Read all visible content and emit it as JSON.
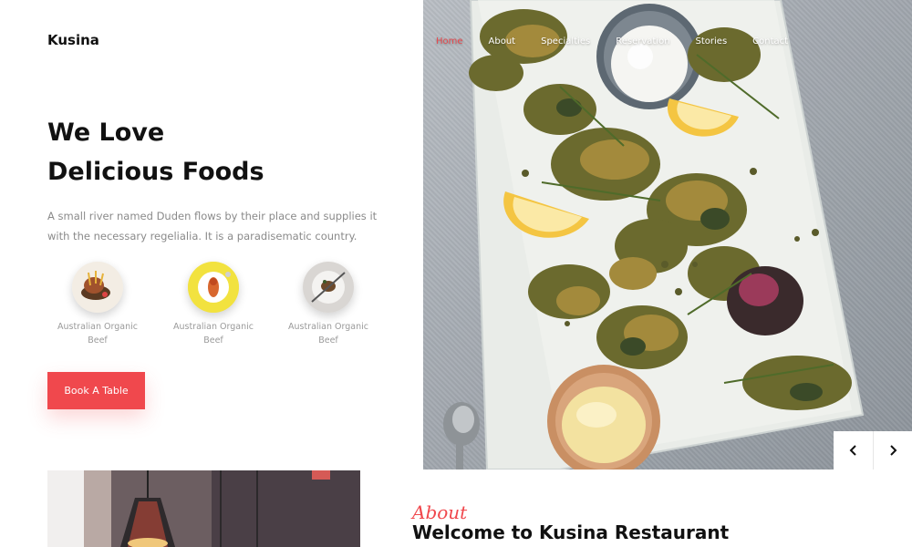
{
  "brand": {
    "name": "Kusina"
  },
  "nav": {
    "items": [
      {
        "label": "Home",
        "active": true
      },
      {
        "label": "About",
        "active": false
      },
      {
        "label": "Specialties",
        "active": false
      },
      {
        "label": "Reservation",
        "active": false
      },
      {
        "label": "Stories",
        "active": false
      },
      {
        "label": "Contact",
        "active": false
      }
    ]
  },
  "hero": {
    "title_line1": "We Love",
    "title_line2": "Delicious Foods",
    "description": "A small river named Duden flows by their place and supplies it with the necessary regelialia. It is a paradisematic country.",
    "cta_label": "Book A Table"
  },
  "dishes": [
    {
      "label": "Australian Organic Beef",
      "thumb_bg": "#f5f0e8"
    },
    {
      "label": "Australian Organic Beef",
      "thumb_bg": "#f3e44a"
    },
    {
      "label": "Australian Organic Beef",
      "thumb_bg": "#ece9e6"
    }
  ],
  "slider": {
    "prev_icon": "chevron-left-icon",
    "next_icon": "chevron-right-icon"
  },
  "about": {
    "script_label": "About",
    "title": "Welcome to Kusina Restaurant"
  },
  "colors": {
    "accent": "#f0484d",
    "text": "#111111",
    "muted": "#8a8a8a"
  }
}
